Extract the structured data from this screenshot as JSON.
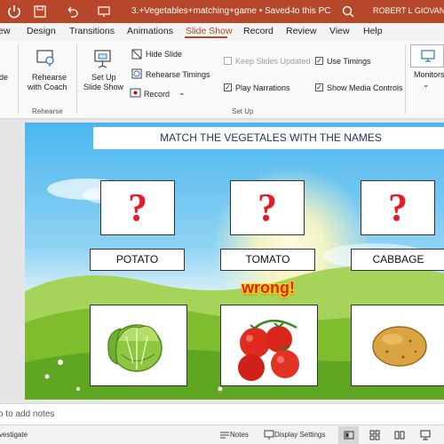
{
  "titlebar": {
    "doc_title": "3.+Vegetables+matching+game  •  Saved to this PC",
    "caret": "⌄",
    "user": "ROBERT L GIOVANELL"
  },
  "tabs": [
    "ew",
    "Design",
    "Transitions",
    "Animations",
    "Slide Show",
    "Record",
    "Review",
    "View",
    "Help"
  ],
  "active_tab": "Slide Show",
  "ribbon": {
    "from_label": "de",
    "rehearse_coach": [
      "Rehearse",
      "with Coach"
    ],
    "rehearse_group": "Rehearse",
    "setup_show": [
      "Set Up",
      "Slide Show"
    ],
    "hide_slide": "Hide Slide",
    "rehearse_timings": "Rehearse Timings",
    "record": "Record",
    "keep_slides_updated": "Keep Slides Updated",
    "play_narrations": "Play Narrations",
    "use_timings": "Use Timings",
    "show_media_controls": "Show Media Controls",
    "setup_group": "Set Up",
    "monitors": "Monitors",
    "checks": {
      "keep_slides_updated": false,
      "play_narrations": true,
      "use_timings": true,
      "show_media_controls": true
    }
  },
  "slide": {
    "title": "MATCH THE VEGETALES WITH THE NAMES",
    "question_mark": "?",
    "names": [
      "POTATO",
      "TOMATO",
      "CABBAGE"
    ],
    "feedback": "wrong!",
    "images": [
      "cabbage",
      "tomato",
      "potato"
    ]
  },
  "notes": {
    "placeholder": "o to add notes"
  },
  "status": {
    "left": "vestigate",
    "notes": "Notes",
    "display_settings": "Display Settings"
  }
}
